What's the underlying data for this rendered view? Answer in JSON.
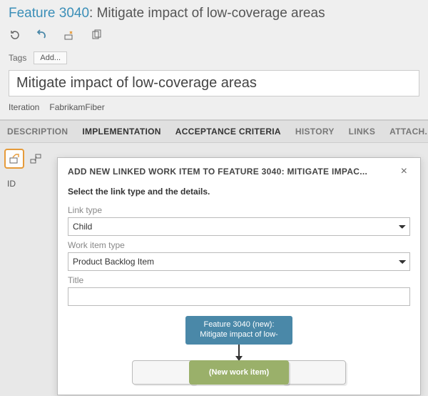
{
  "header": {
    "feature_label": "Feature 3040",
    "feature_rest": ": Mitigate impact of low-coverage areas"
  },
  "tags": {
    "label": "Tags",
    "add_label": "Add..."
  },
  "title_field": {
    "value": "Mitigate impact of low-coverage areas"
  },
  "iteration": {
    "label": "Iteration",
    "value": "FabrikamFiber"
  },
  "tabs": {
    "description": "DESCRIPTION",
    "implementation": "IMPLEMENTATION",
    "acceptance": "ACCEPTANCE CRITERIA",
    "history": "HISTORY",
    "links": "LINKS",
    "attachments": "ATTACH..."
  },
  "left": {
    "id_label": "ID"
  },
  "dialog": {
    "title": "ADD NEW LINKED WORK ITEM TO FEATURE 3040: MITIGATE IMPAC...",
    "instruction": "Select the link type and the details.",
    "link_type_label": "Link type",
    "link_type_value": "Child",
    "work_item_type_label": "Work item type",
    "work_item_type_value": "Product Backlog Item",
    "title_label": "Title",
    "title_value": "",
    "diagram": {
      "parent_line1": "Feature 3040 (new):",
      "parent_line2": "Mitigate impact of low-",
      "new_item": "(New work item)"
    }
  }
}
